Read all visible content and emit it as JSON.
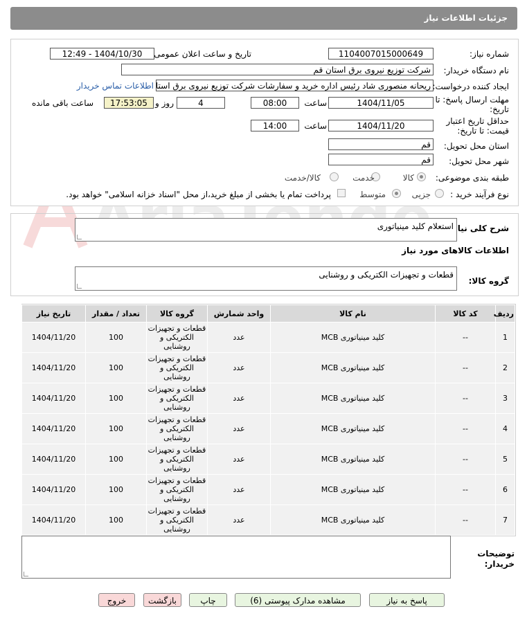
{
  "header": {
    "title": "جزئیات اطلاعات نیاز"
  },
  "form": {
    "need_number_label": "شماره نیاز:",
    "need_number": "1104007015000649",
    "announce_label": "تاریخ و ساعت اعلان عمومی:",
    "announce_value": "1404/10/30 - 12:49",
    "buyer_org_label": "نام دستگاه خریدار:",
    "buyer_org": "شرکت توزیع نیروی برق استان قم",
    "creator_label": "ایجاد کننده درخواست:",
    "creator": "ریحانه منصوری شاد رئیس اداره خرید و سفارشات شرکت توزیع نیروی برق استان قم",
    "contact_link": "اطلاعات تماس خریدار",
    "reply_deadline_label_1": "مهلت ارسال پاسخ: تا",
    "reply_deadline_label_2": "تاریخ:",
    "reply_date": "1404/11/05",
    "time_label": "ساعت",
    "reply_time": "08:00",
    "days_value": "4",
    "days_label": "روز و",
    "remaining_time": "17:53:05",
    "remaining_label": "ساعت باقی مانده",
    "validity_label_1": "حداقل تاریخ اعتبار",
    "validity_label_2": "قیمت: تا تاریخ:",
    "validity_date": "1404/11/20",
    "validity_time": "14:00",
    "province_label": "استان محل تحویل:",
    "province": "قم",
    "city_label": "شهر محل تحویل:",
    "city": "قم",
    "category_label": "طبقه بندی موضوعی:",
    "category_options": [
      "کالا",
      "خدمت",
      "کالا/خدمت"
    ],
    "category_selected": "کالا",
    "purchase_type_label": "نوع فرآیند خرید :",
    "purchase_options": [
      "جزیی",
      "متوسط"
    ],
    "purchase_selected": "جزیی",
    "payment_note": "پرداخت تمام یا بخشی از مبلغ خرید،از محل \"اسناد خزانه اسلامی\" خواهد بود."
  },
  "summary": {
    "general_desc_label": "شرح کلی نیاز:",
    "general_desc": "استعلام کلید مینیاتوری",
    "goods_info_title": "اطلاعات کالاهای مورد نیاز",
    "goods_group_label": "گروه کالا:",
    "goods_group": "قطعات و تجهیزات الکتریکی و روشنایی"
  },
  "table": {
    "headers": [
      "ردیف",
      "کد کالا",
      "نام کالا",
      "واحد شمارش",
      "گروه کالا",
      "تعداد / مقدار",
      "تاریخ نیاز"
    ],
    "rows": [
      [
        "1",
        "--",
        "کلید مینیاتوری MCB",
        "عدد",
        "قطعات و تجهیزات الکتریکی و روشنایی",
        "100",
        "1404/11/20"
      ],
      [
        "2",
        "--",
        "کلید مینیاتوری MCB",
        "عدد",
        "قطعات و تجهیزات الکتریکی و روشنایی",
        "100",
        "1404/11/20"
      ],
      [
        "3",
        "--",
        "کلید مینیاتوری MCB",
        "عدد",
        "قطعات و تجهیزات الکتریکی و روشنایی",
        "100",
        "1404/11/20"
      ],
      [
        "4",
        "--",
        "کلید مینیاتوری MCB",
        "عدد",
        "قطعات و تجهیزات الکتریکی و روشنایی",
        "100",
        "1404/11/20"
      ],
      [
        "5",
        "--",
        "کلید مینیاتوری MCB",
        "عدد",
        "قطعات و تجهیزات الکتریکی و روشنایی",
        "100",
        "1404/11/20"
      ],
      [
        "6",
        "--",
        "کلید مینیاتوری MCB",
        "عدد",
        "قطعات و تجهیزات الکتریکی و روشنایی",
        "100",
        "1404/11/20"
      ],
      [
        "7",
        "--",
        "کلید مینیاتوری MCB",
        "عدد",
        "قطعات و تجهیزات الکتریکی و روشنایی",
        "100",
        "1404/11/20"
      ]
    ]
  },
  "buyer_notes": {
    "label_1": "توضیحات",
    "label_2": "خریدار:"
  },
  "watermark": {
    "text": "AriaTender.neT"
  },
  "buttons": {
    "reply": "پاسخ به نیاز",
    "attachments": "مشاهده مدارک پیوستی (6)",
    "print": "چاپ",
    "back": "بازگشت",
    "exit": "خروج"
  },
  "colors": {
    "header_bg": "#8c8c8c",
    "link": "#2a5ea8",
    "remaining_bg": "#f5f2c8"
  }
}
